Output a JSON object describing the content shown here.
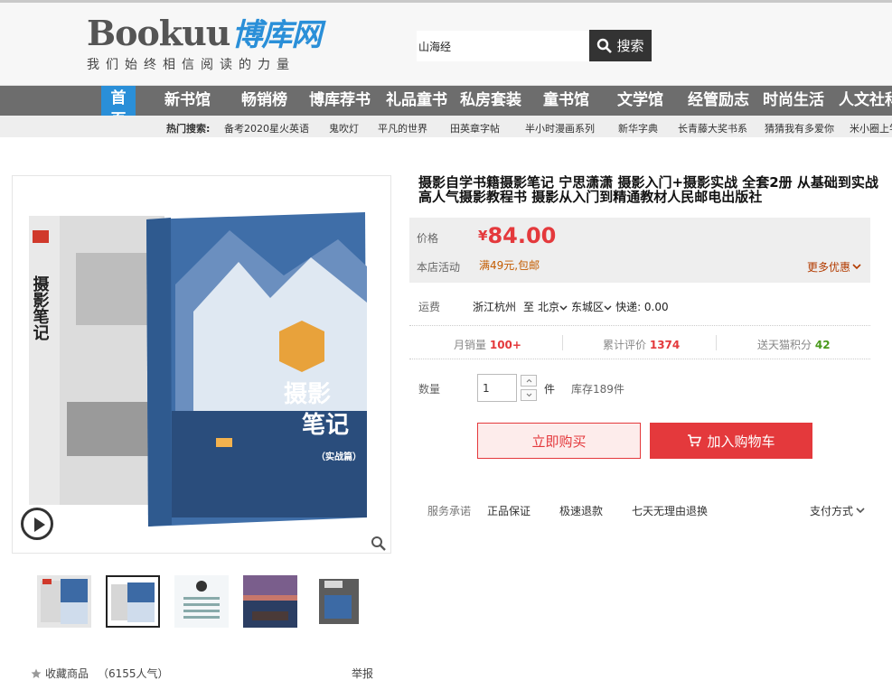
{
  "header": {
    "logo_text": "Bookuu",
    "logo_cn": "博库网",
    "slogan": "我们始终相信阅读的力量",
    "search_value": "山海经",
    "search_button": "搜索"
  },
  "nav": {
    "home": [
      "首",
      "页"
    ],
    "items": [
      "新书馆",
      "畅销榜",
      "博库荐书",
      "礼品童书",
      "私房套装",
      "童书馆",
      "文学馆",
      "经管励志",
      "时尚生活",
      "人文社科"
    ]
  },
  "hot_search": {
    "label": "热门搜索:",
    "items": [
      "备考2020星火英语",
      "鬼吹灯",
      "平凡的世界",
      "田英章字帖",
      "半小时漫画系列",
      "新华字典",
      "长青藤大奖书系",
      "猜猜我有多爱你",
      "米小圈上学记"
    ]
  },
  "gallery": {
    "favorite_label": "收藏商品",
    "favorite_count": "（6155人气）",
    "report_label": "举报",
    "cover_back_title": "摄影笔记",
    "cover_front_title": "摄影笔记",
    "cover_front_sub": "（实战篇）"
  },
  "product": {
    "title": "摄影自学书籍摄影笔记 宁思潇潇 摄影入门+摄影实战 全套2册 从基础到实战高人气摄影教程书 摄影从入门到精通教材人民邮电出版社",
    "price_label": "价格",
    "currency": "¥",
    "price": "84.00",
    "promo_label": "本店活动",
    "promo": "满49元,包邮",
    "more_offers": "更多优惠",
    "shipping_label": "运费",
    "ship_from": "浙江杭州",
    "ship_to": "至",
    "province": "北京",
    "district": "东城区",
    "express": "快递: 0.00",
    "monthly_sales_label": "月销量",
    "monthly_sales": "100+",
    "reviews_label": "累计评价",
    "reviews": "1374",
    "points_label": "送天猫积分",
    "points": "42",
    "quantity_label": "数量",
    "quantity": "1",
    "unit": "件",
    "stock": "库存189件",
    "buy_now": "立即购买",
    "add_cart": "加入购物车",
    "service_label": "服务承诺",
    "services": [
      "正品保证",
      "极速退款",
      "七天无理由退换"
    ],
    "payment": "支付方式"
  },
  "colors": {
    "accent_red": "#e4393c",
    "brand_blue": "#2a8fd8",
    "nav_gray": "#6d6d6d"
  }
}
